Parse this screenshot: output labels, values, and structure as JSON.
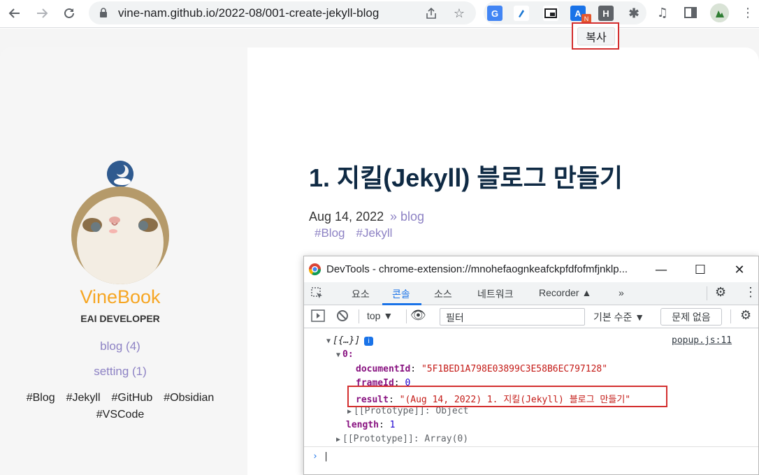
{
  "browser": {
    "url": "vine-nam.github.io/2022-08/001-create-jekyll-blog",
    "extensions": [
      {
        "name": "google-translate-icon",
        "letter": "G",
        "color": "#4285f4"
      },
      {
        "name": "extension-dark-icon",
        "letter": "",
        "color": "#202124"
      },
      {
        "name": "picture-in-picture-icon",
        "letter": "",
        "color": "#202124"
      },
      {
        "name": "extension-a-icon",
        "letter": "A",
        "color": "#1a73e8"
      },
      {
        "name": "extension-h-icon",
        "letter": "H",
        "color": "#5f6368"
      }
    ],
    "badge": "N",
    "tooltip": "복사"
  },
  "sidebar": {
    "title": "VineBook",
    "subtitle": "EAI DEVELOPER",
    "links": [
      {
        "label": "blog (4)"
      },
      {
        "label": "setting (1)"
      }
    ],
    "tags_row1": [
      "#Blog",
      "#Jekyll",
      "#GitHub",
      "#Obsidian"
    ],
    "tags_row2": [
      "#VSCode"
    ]
  },
  "post": {
    "title": "1. 지킬(Jekyll) 블로그 만들기",
    "date": "Aug 14, 2022",
    "category_prefix": "»",
    "category": "blog",
    "tags": [
      "#Blog",
      "#Jekyll"
    ]
  },
  "devtools": {
    "title": "DevTools - chrome-extension://mnohefaognkeafckpfdfofmfjnklp...",
    "tabs": [
      {
        "label": "요소",
        "active": false
      },
      {
        "label": "콘솔",
        "active": true
      },
      {
        "label": "소스",
        "active": false
      },
      {
        "label": "네트워크",
        "active": false
      },
      {
        "label": "Recorder ▲",
        "active": false
      },
      {
        "label": "»",
        "active": false
      }
    ],
    "context": "top ▼",
    "filter_placeholder": "필터",
    "level": "기본 수준 ▼",
    "issues": "문제 없음",
    "source_link": "popup.js:11",
    "console": {
      "root": "[{…}]",
      "index": "0:",
      "documentId_key": "documentId",
      "documentId_val": "\"5F1BED1A798E03899C3E58B6EC797128\"",
      "frameId_key": "frameId",
      "frameId_val": "0",
      "result_key": "result",
      "result_val": "\"(Aug 14, 2022) 1. 지킬(Jekyll) 블로그 만들기\"",
      "proto_inner": "[[Prototype]]: Object",
      "length_key": "length",
      "length_val": "1",
      "proto_outer": "[[Prototype]]: Array(0)"
    }
  },
  "colors": {
    "accent_orange": "#f6a623",
    "link_purple": "#8d82c4",
    "title_navy": "#0f2a44",
    "highlight_red": "#d32f2f",
    "devtools_blue": "#1a73e8"
  }
}
